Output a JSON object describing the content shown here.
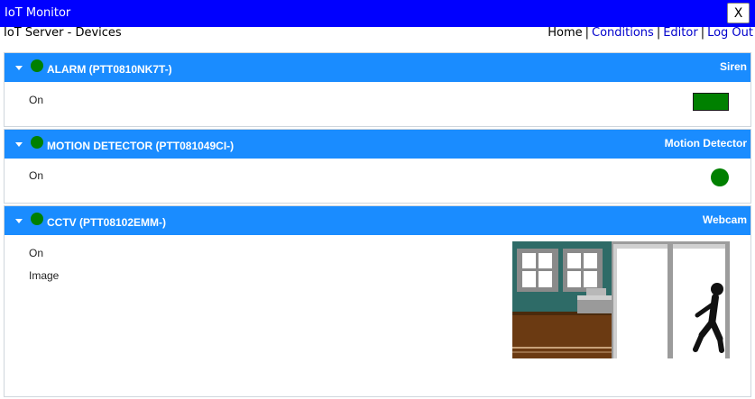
{
  "app": {
    "title": "IoT Monitor",
    "close_label": "X"
  },
  "header": {
    "page_title": "IoT Server - Devices",
    "nav": [
      {
        "label": "Home"
      },
      {
        "label": "Conditions"
      },
      {
        "label": "Editor"
      },
      {
        "label": "Log Out"
      }
    ],
    "separator": "|"
  },
  "devices": [
    {
      "name": "ALARM (PTT0810NK7T-)",
      "type": "Siren",
      "status_color": "#008000",
      "properties": [
        {
          "label": "On",
          "control": "switch",
          "state": "on"
        }
      ]
    },
    {
      "name": "MOTION DETECTOR (PTT081049CI-)",
      "type": "Motion Detector",
      "status_color": "#008000",
      "properties": [
        {
          "label": "On",
          "control": "indicator",
          "state": "on"
        }
      ]
    },
    {
      "name": "CCTV (PTT08102EMM-)",
      "type": "Webcam",
      "status_color": "#008000",
      "properties": [
        {
          "label": "On",
          "control": "switch",
          "state": "on"
        },
        {
          "label": "Image",
          "control": "camera-image"
        }
      ]
    }
  ],
  "colors": {
    "titlebar": "#0000ff",
    "panel_header": "#1a8cff",
    "status_on": "#008000",
    "link": "#0000cc"
  }
}
